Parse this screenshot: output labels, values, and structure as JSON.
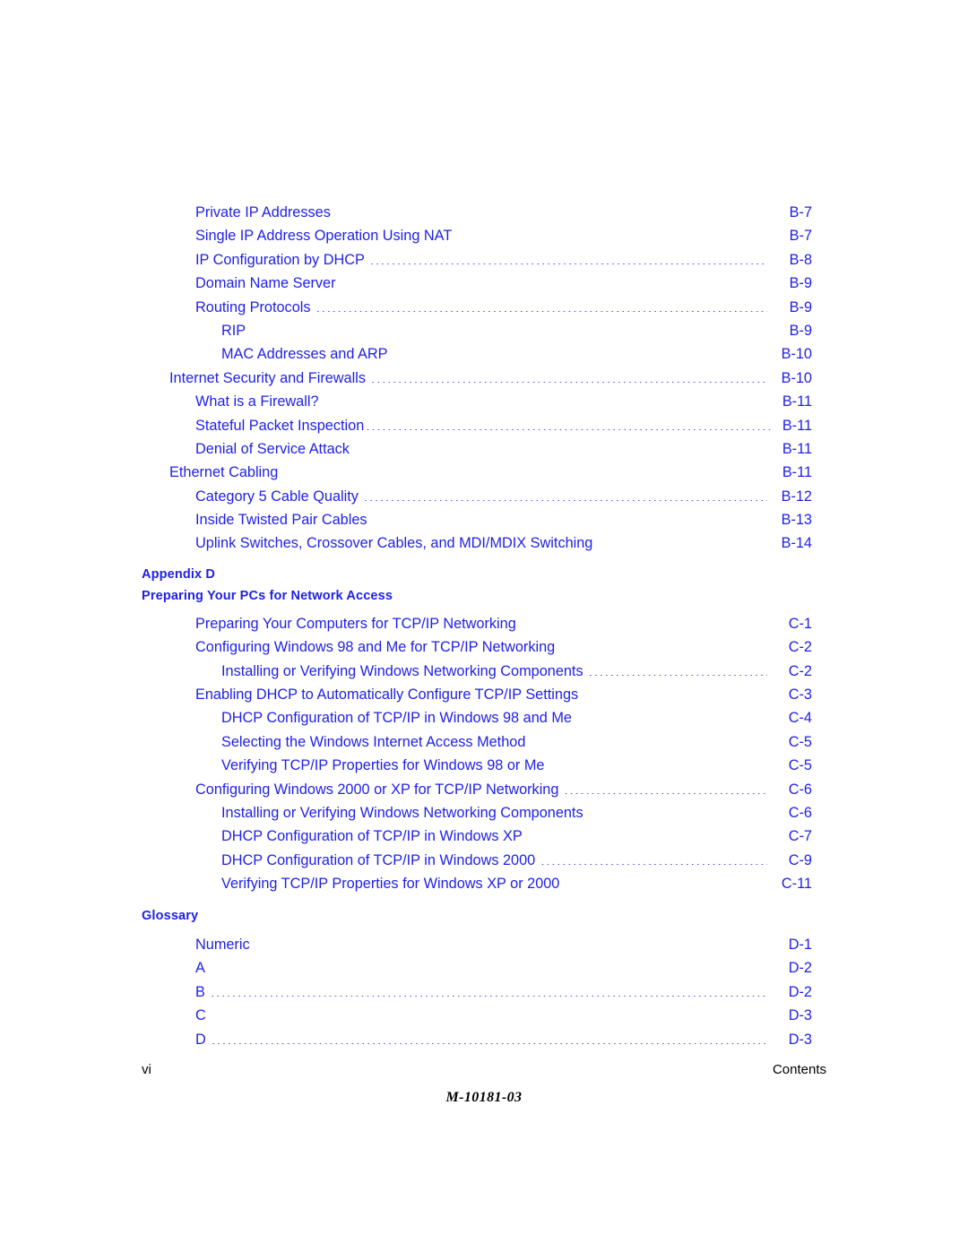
{
  "document": {
    "page_label": "vi",
    "footer_section": "Contents",
    "doc_number": "M-10181-03",
    "accent_color": "#1f1fe8",
    "footer_color": "#000000"
  },
  "toc": {
    "blocks": [
      {
        "kind": "entries",
        "entries": [
          {
            "title": "Private IP Addresses",
            "page": "B-7",
            "level": 1,
            "tight": false
          },
          {
            "title": "Single IP Address Operation Using NAT",
            "page": "B-7",
            "level": 1,
            "tight": false
          },
          {
            "title": "IP Configuration by DHCP",
            "page": "B-8",
            "level": 1,
            "tight": false
          },
          {
            "title": "Domain Name Server",
            "page": "B-9",
            "level": 1,
            "tight": false
          },
          {
            "title": "Routing Protocols",
            "page": "B-9",
            "level": 1,
            "tight": false
          },
          {
            "title": "RIP",
            "page": "B-9",
            "level": 2,
            "tight": false
          },
          {
            "title": "MAC Addresses and ARP",
            "page": "B-10",
            "level": 2,
            "tight": false
          },
          {
            "title": "Internet Security and Firewalls",
            "page": "B-10",
            "level": 0,
            "tight": false
          },
          {
            "title": "What is a Firewall?",
            "page": "B-11",
            "level": 1,
            "tight": true
          },
          {
            "title": "Stateful Packet Inspection",
            "page": "B-11",
            "level": 1,
            "tight": true
          },
          {
            "title": "Denial of Service Attack",
            "page": "B-11",
            "level": 1,
            "tight": true
          },
          {
            "title": "Ethernet Cabling",
            "page": "B-11",
            "level": 0,
            "tight": true
          },
          {
            "title": "Category 5 Cable Quality",
            "page": "B-12",
            "level": 1,
            "tight": false
          },
          {
            "title": "Inside Twisted Pair Cables",
            "page": "B-13",
            "level": 1,
            "tight": false
          },
          {
            "title": "Uplink Switches, Crossover Cables, and MDI/MDIX Switching",
            "page": "B-14",
            "level": 1,
            "tight": false
          }
        ]
      },
      {
        "kind": "heading",
        "lines": [
          "Appendix D",
          "Preparing Your PCs for Network Access"
        ]
      },
      {
        "kind": "entries",
        "entries": [
          {
            "title": "Preparing Your Computers for TCP/IP Networking",
            "page": "C-1",
            "level": 1,
            "tight": false
          },
          {
            "title": "Configuring Windows 98 and Me for TCP/IP Networking",
            "page": "C-2",
            "level": 1,
            "tight": false
          },
          {
            "title": "Installing or Verifying Windows Networking Components",
            "page": "C-2",
            "level": 2,
            "tight": false
          },
          {
            "title": "Enabling DHCP to Automatically Configure TCP/IP Settings",
            "page": "C-3",
            "level": 1,
            "tight": false
          },
          {
            "title": "DHCP Configuration of TCP/IP in Windows 98 and Me",
            "page": "C-4",
            "level": 2,
            "tight": false
          },
          {
            "title": "Selecting the Windows Internet Access Method",
            "page": "C-5",
            "level": 2,
            "tight": false
          },
          {
            "title": "Verifying TCP/IP Properties for Windows 98 or Me",
            "page": "C-5",
            "level": 2,
            "tight": false
          },
          {
            "title": "Configuring Windows 2000 or XP for TCP/IP Networking",
            "page": "C-6",
            "level": 1,
            "tight": false
          },
          {
            "title": "Installing or Verifying Windows Networking Components",
            "page": "C-6",
            "level": 2,
            "tight": false
          },
          {
            "title": "DHCP Configuration of TCP/IP in Windows XP",
            "page": "C-7",
            "level": 2,
            "tight": false
          },
          {
            "title": "DHCP Configuration of TCP/IP in Windows 2000",
            "page": "C-9",
            "level": 2,
            "tight": false
          },
          {
            "title": "Verifying TCP/IP Properties for Windows XP or 2000",
            "page": "C-11",
            "level": 2,
            "tight": false
          }
        ]
      },
      {
        "kind": "heading",
        "lines": [
          "Glossary"
        ]
      },
      {
        "kind": "entries",
        "entries": [
          {
            "title": "Numeric",
            "page": "D-1",
            "level": 1,
            "tight": false
          },
          {
            "title": "A",
            "page": "D-2",
            "level": 1,
            "tight": false
          },
          {
            "title": "B",
            "page": "D-2",
            "level": 1,
            "tight": false
          },
          {
            "title": "C",
            "page": "D-3",
            "level": 1,
            "tight": false
          },
          {
            "title": "D",
            "page": "D-3",
            "level": 1,
            "tight": false
          }
        ]
      }
    ]
  }
}
